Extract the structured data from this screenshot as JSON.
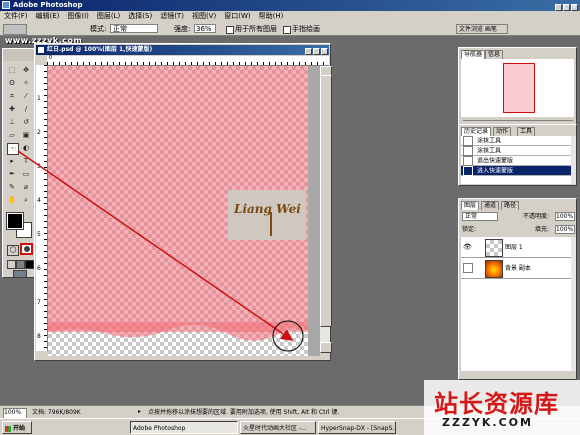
{
  "app": {
    "title": "Adobe Photoshop"
  },
  "menu": [
    "文件(F)",
    "编辑(E)",
    "图像(I)",
    "图层(L)",
    "选择(S)",
    "滤镜(T)",
    "视图(V)",
    "窗口(W)",
    "帮助(H)"
  ],
  "options_bar": {
    "mode_label": "模式:",
    "mode_value": "正常",
    "opacity_label": "强度:",
    "opacity_value": "36%",
    "check1": "用于所有图层",
    "check2": "手指绘画",
    "right_tab": "文件浏览 画笔"
  },
  "watermark_top": "www.zzzyk.com",
  "document": {
    "title": "红日.psd @ 100%(图层 1,快速蒙版)",
    "ruler_labels": [
      "0",
      "1",
      "2",
      "3",
      "4",
      "5",
      "6",
      "7",
      "8"
    ],
    "logo_text": "Liang Wei"
  },
  "navigator": {
    "tabs": [
      "导航器",
      "信息"
    ]
  },
  "history": {
    "tabs": [
      "历史记录",
      "动作",
      "工具"
    ],
    "items": [
      "涂抹工具",
      "涂抹工具",
      "退出快速蒙版",
      "进入快速蒙版"
    ]
  },
  "layers": {
    "tabs": [
      "图层",
      "通道",
      "路径"
    ],
    "mode_value": "正常",
    "opacity_label": "不透明度:",
    "opacity_value": "100%",
    "lock_label": "锁定:",
    "fill_label": "填充:",
    "fill_value": "100%",
    "items": [
      "图层 1",
      "背景 副本"
    ]
  },
  "statusbar": {
    "zoom": "100%",
    "doc": "文档: 796K/809K",
    "hint": "点按并拖移以涂抹想要的区域. 要用附加选项, 使用 Shift, Alt 和 Ctrl 键."
  },
  "watermark": {
    "main": "站长资源库",
    "url": "ZZZYK.COM"
  },
  "taskbar": {
    "start": "开始",
    "tasks": [
      "Adobe Photoshop",
      "火星时代动画大社区 -...",
      "HyperSnap-DX - [SnapS...]"
    ]
  },
  "colors": {
    "pink": "#f4a9ad",
    "arrow": "#cc1010"
  }
}
